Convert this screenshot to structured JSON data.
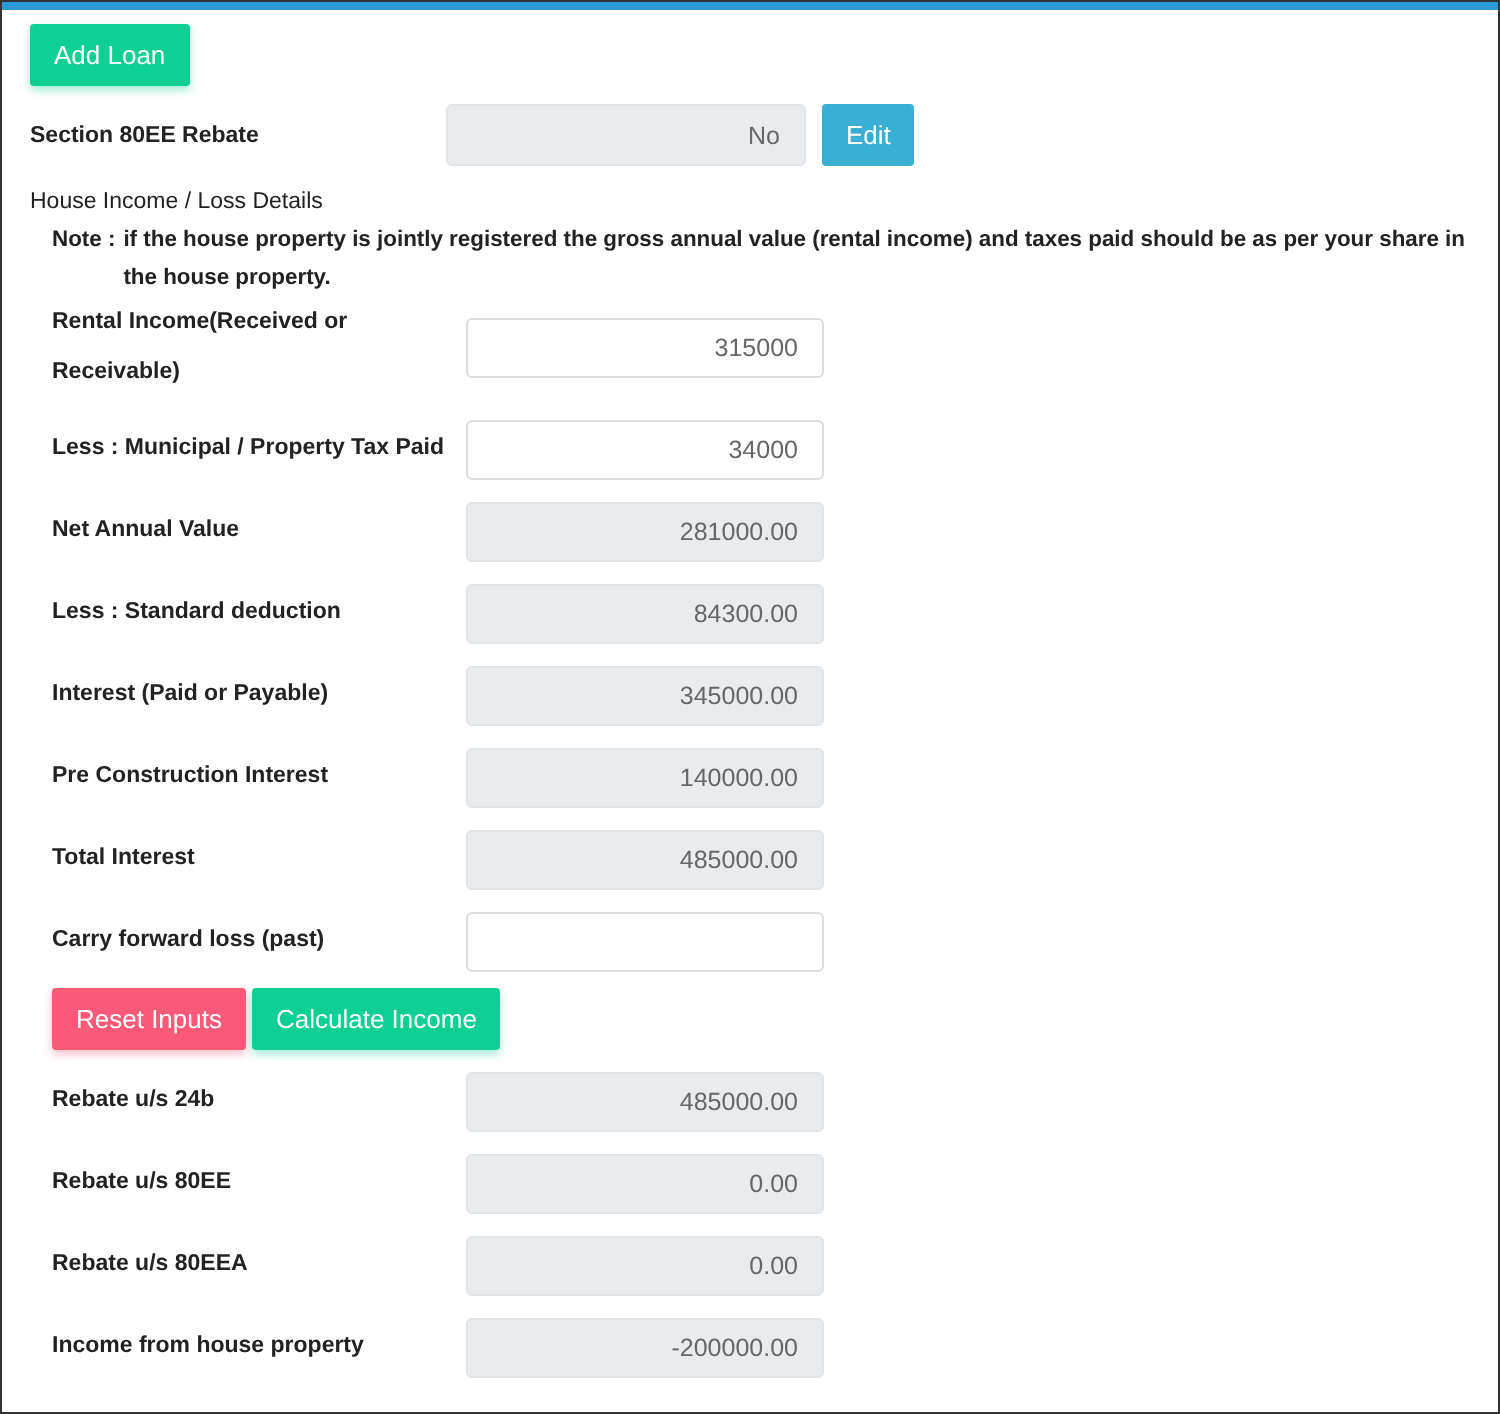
{
  "add_loan_button": "Add Loan",
  "rebate_80ee": {
    "label": "Section 80EE Rebate",
    "value": "No",
    "readonly": true,
    "edit_button": "Edit"
  },
  "section_title": "House Income / Loss Details",
  "note": {
    "label": "Note :",
    "text": "if the house property is jointly registered the gross annual value (rental income) and taxes paid should be as per your share in the house property."
  },
  "fields": [
    {
      "label": "Rental Income(Received or Receivable)",
      "value": "315000",
      "readonly": false
    },
    {
      "label": "Less : Municipal / Property Tax Paid",
      "value": "34000",
      "readonly": false
    },
    {
      "label": "Net Annual Value",
      "value": "281000.00",
      "readonly": true
    },
    {
      "label": "Less : Standard deduction",
      "value": "84300.00",
      "readonly": true
    },
    {
      "label": "Interest (Paid or Payable)",
      "value": "345000.00",
      "readonly": true
    },
    {
      "label": "Pre Construction Interest",
      "value": "140000.00",
      "readonly": true
    },
    {
      "label": "Total Interest",
      "value": "485000.00",
      "readonly": true
    },
    {
      "label": "Carry forward loss (past)",
      "readonly": false
    }
  ],
  "buttons": [
    {
      "label": "Reset Inputs",
      "kind": "reset"
    },
    {
      "label": "Calculate Income",
      "kind": "calculate"
    }
  ],
  "results": [
    {
      "label": "Rebate u/s 24b",
      "value": "485000.00",
      "readonly": true
    },
    {
      "label": "Rebate u/s 80EE",
      "value": "0.00",
      "readonly": true
    },
    {
      "label": "Rebate u/s 80EEA",
      "value": "0.00",
      "readonly": true
    },
    {
      "label": "Income from house property",
      "value": "-200000.00",
      "readonly": true
    }
  ]
}
